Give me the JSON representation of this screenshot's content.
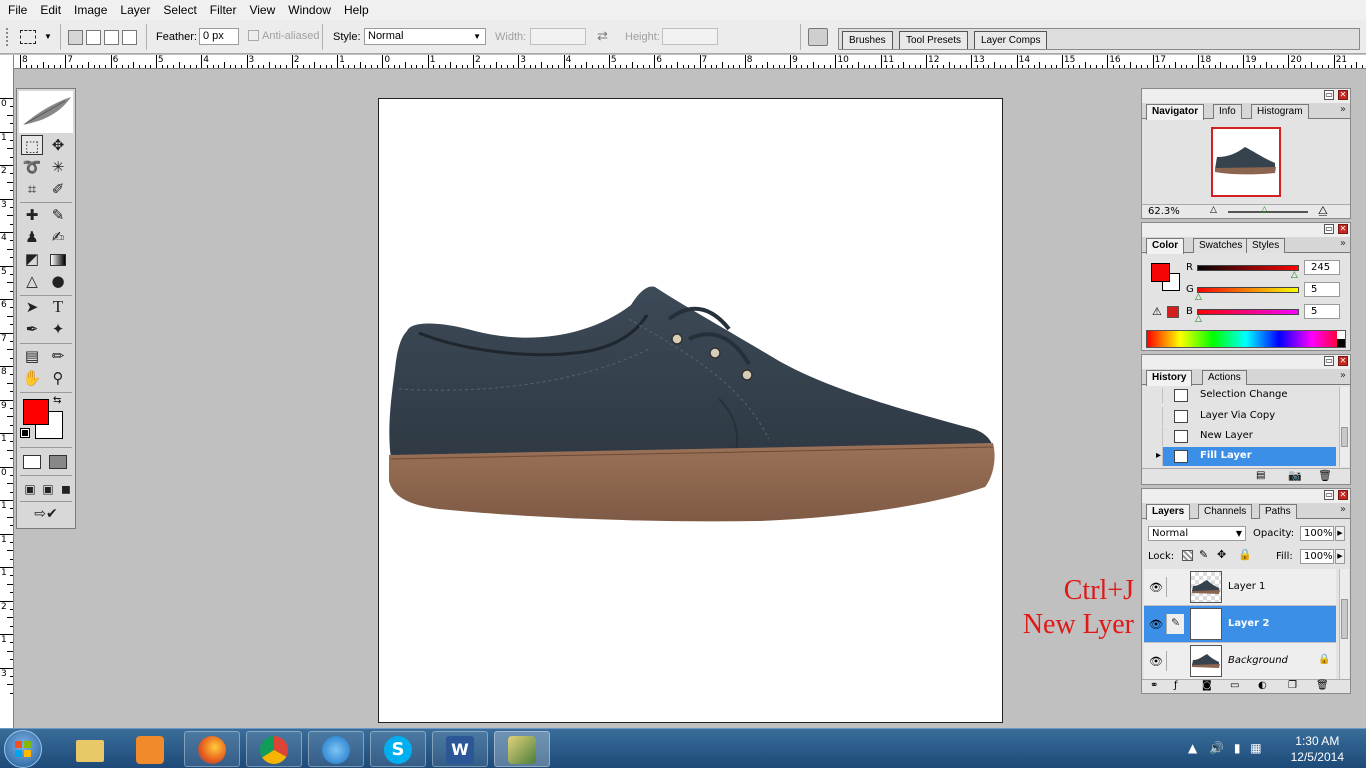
{
  "menu": [
    "File",
    "Edit",
    "Image",
    "Layer",
    "Select",
    "Filter",
    "View",
    "Window",
    "Help"
  ],
  "options": {
    "feather_label": "Feather:",
    "feather_value": "0 px",
    "antialiased_label": "Anti-aliased",
    "style_label": "Style:",
    "style_value": "Normal",
    "width_label": "Width:",
    "height_label": "Height:"
  },
  "palette_well": {
    "tabs": [
      "Brushes",
      "Tool Presets",
      "Layer Comps"
    ]
  },
  "rulers": {
    "top": [
      "8",
      "7",
      "6",
      "5",
      "4",
      "3",
      "2",
      "1",
      "0",
      "1",
      "2",
      "3",
      "4",
      "5",
      "6",
      "7",
      "8",
      "9",
      "10",
      "11",
      "12",
      "13",
      "14",
      "15",
      "16",
      "17",
      "18",
      "19",
      "20",
      "21"
    ],
    "left": [
      "0",
      "1",
      "2",
      "3",
      "4",
      "5",
      "6",
      "7",
      "8",
      "9",
      "1",
      "0",
      "1",
      "1",
      "1",
      "2",
      "1",
      "3"
    ]
  },
  "toolbox": {
    "foreground_color": "#ff0000",
    "background_color": "#ffffff"
  },
  "navigator": {
    "tabs": [
      "Navigator",
      "Info",
      "Histogram"
    ],
    "zoom": "62.3%"
  },
  "color_panel": {
    "tabs": [
      "Color",
      "Swatches",
      "Styles"
    ],
    "r_label": "R",
    "r_value": "245",
    "r_fraction": 0.96,
    "g_label": "G",
    "g_value": "5",
    "g_fraction": 0.02,
    "b_label": "B",
    "b_value": "5",
    "b_fraction": 0.02,
    "swatch_color": "#f50505"
  },
  "history": {
    "tabs": [
      "History",
      "Actions"
    ],
    "items": [
      "Selection Change",
      "Layer Via Copy",
      "New Layer",
      "Fill Layer"
    ]
  },
  "layers": {
    "tabs": [
      "Layers",
      "Channels",
      "Paths"
    ],
    "blend_mode": "Normal",
    "opacity_label": "Opacity:",
    "opacity_value": "100%",
    "lock_label": "Lock:",
    "fill_label": "Fill:",
    "fill_value": "100%",
    "items": [
      "Layer 1",
      "Layer 2",
      "Background"
    ]
  },
  "annotation": {
    "line1": "Ctrl+J",
    "line2": "New Lyer"
  },
  "taskbar": {
    "time": "1:30 AM",
    "date": "12/5/2014"
  }
}
